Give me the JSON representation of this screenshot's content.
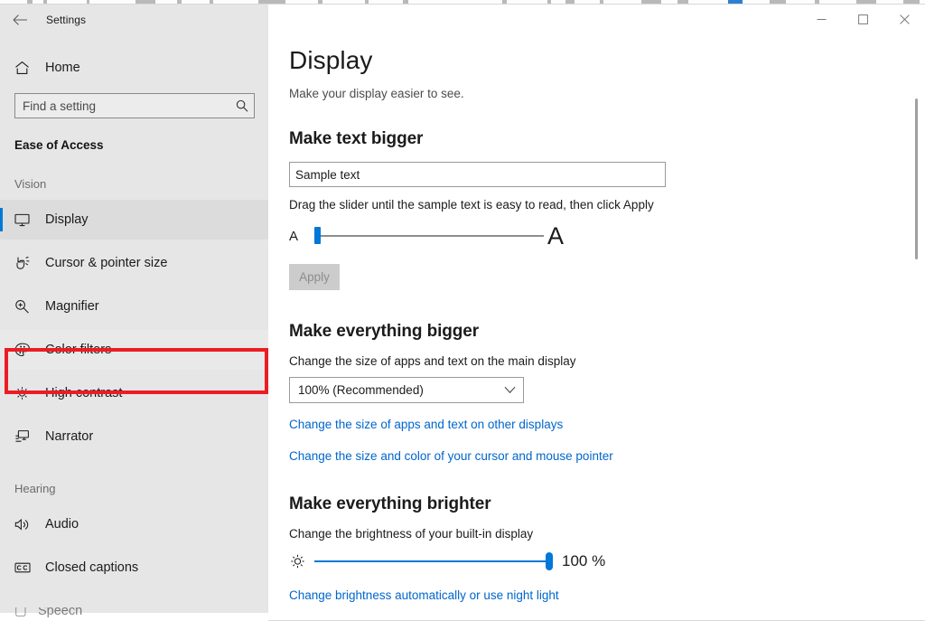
{
  "window": {
    "app_title": "Settings",
    "back_icon": "back-arrow-icon",
    "minimize_label": "–",
    "maximize_label": "□",
    "close_label": "×"
  },
  "sidebar": {
    "home": {
      "label": "Home",
      "icon": "home-icon"
    },
    "search": {
      "placeholder": "Find a setting",
      "value": "",
      "icon": "search-icon"
    },
    "category": "Ease of Access",
    "groups": [
      {
        "label": "Vision",
        "items": [
          {
            "label": "Display",
            "icon": "monitor-icon",
            "selected": true,
            "highlighted": false
          },
          {
            "label": "Cursor & pointer size",
            "icon": "cursor-pointer-icon",
            "selected": false,
            "highlighted": false
          },
          {
            "label": "Magnifier",
            "icon": "magnifier-icon",
            "selected": false,
            "highlighted": false
          },
          {
            "label": "Color filters",
            "icon": "palette-icon",
            "selected": false,
            "highlighted": true
          },
          {
            "label": "High contrast",
            "icon": "sun-contrast-icon",
            "selected": false,
            "highlighted": false
          },
          {
            "label": "Narrator",
            "icon": "narrator-icon",
            "selected": false,
            "highlighted": false
          }
        ]
      },
      {
        "label": "Hearing",
        "items": [
          {
            "label": "Audio",
            "icon": "speaker-icon",
            "selected": false,
            "highlighted": false
          },
          {
            "label": "Closed captions",
            "icon": "closed-captions-icon",
            "selected": false,
            "highlighted": false
          }
        ]
      }
    ],
    "highlight_color": "#ec1c24",
    "accent_color": "#0078d7"
  },
  "main": {
    "page_title": "Display",
    "subtitle": "Make your display easier to see.",
    "text_section": {
      "heading": "Make text bigger",
      "sample_value": "Sample text",
      "sample_placeholder": "Sample text",
      "hint": "Drag the slider until the sample text is easy to read, then click Apply",
      "slider_min_label": "A",
      "slider_max_label": "A",
      "slider_value": 0,
      "apply_label": "Apply",
      "apply_enabled": false
    },
    "scale_section": {
      "heading": "Make everything bigger",
      "label": "Change the size of apps and text on the main display",
      "dropdown_value": "100% (Recommended)",
      "dropdown_icon": "chevron-down-icon",
      "link_other_displays": "Change the size of apps and text on other displays",
      "link_cursor": "Change the size and color of your cursor and mouse pointer"
    },
    "brightness_section": {
      "heading": "Make everything brighter",
      "label": "Change the brightness of your built-in display",
      "slider_icon": "brightness-sun-icon",
      "slider_value": 100,
      "value_label": "100 %",
      "link_night_light": "Change brightness automatically or use night light"
    }
  }
}
